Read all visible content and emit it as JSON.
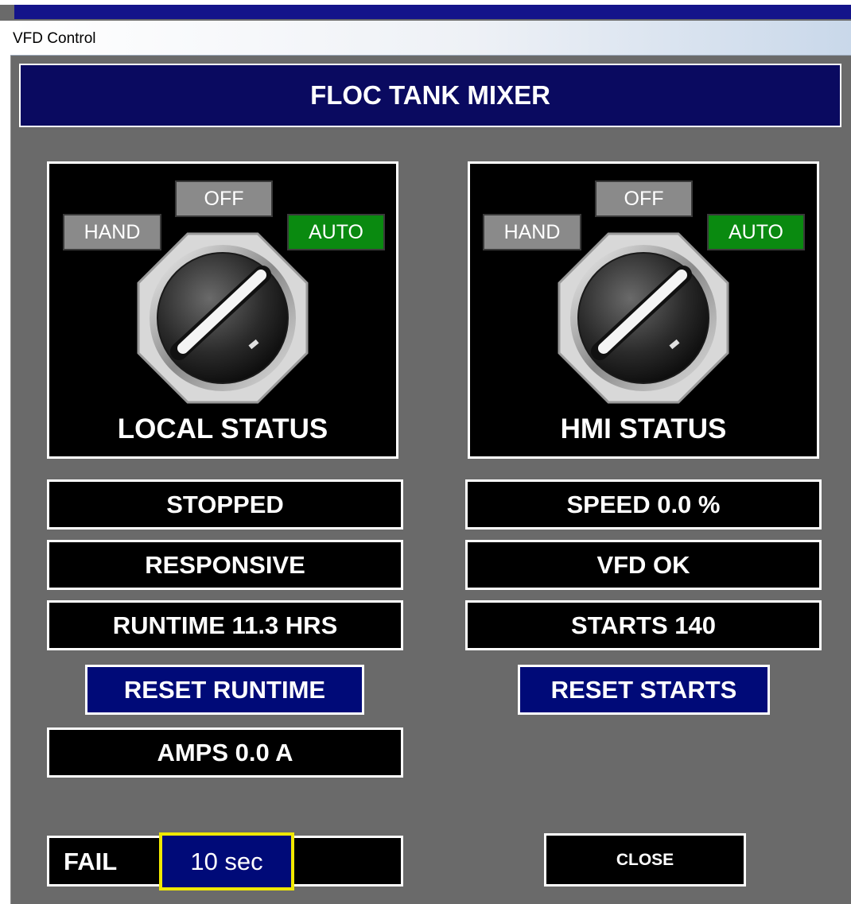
{
  "window": {
    "title": "VFD Control"
  },
  "header": {
    "title": "FLOC TANK MIXER"
  },
  "local_switch": {
    "hand": "HAND",
    "off": "OFF",
    "auto": "AUTO",
    "selected": "AUTO",
    "caption": "LOCAL STATUS"
  },
  "hmi_switch": {
    "hand": "HAND",
    "off": "OFF",
    "auto": "AUTO",
    "selected": "AUTO",
    "caption": "HMI STATUS"
  },
  "status": {
    "run_state": "STOPPED",
    "comm_state": "RESPONSIVE",
    "runtime": "RUNTIME 11.3 HRS",
    "speed": "SPEED 0.0 %",
    "vfd_state": "VFD OK",
    "starts": "STARTS 140",
    "amps": "AMPS 0.0 A"
  },
  "buttons": {
    "reset_runtime": "RESET RUNTIME",
    "reset_starts": "RESET STARTS",
    "close": "CLOSE"
  },
  "fail": {
    "label": "FAIL",
    "time": "10 sec"
  },
  "colors": {
    "background": "#6a6a6a",
    "header": "#0a0a60",
    "button_blue": "#000a78",
    "auto_green": "#0a8a10",
    "tag_gray": "#8a8a8a",
    "fail_highlight": "#f0e800"
  }
}
